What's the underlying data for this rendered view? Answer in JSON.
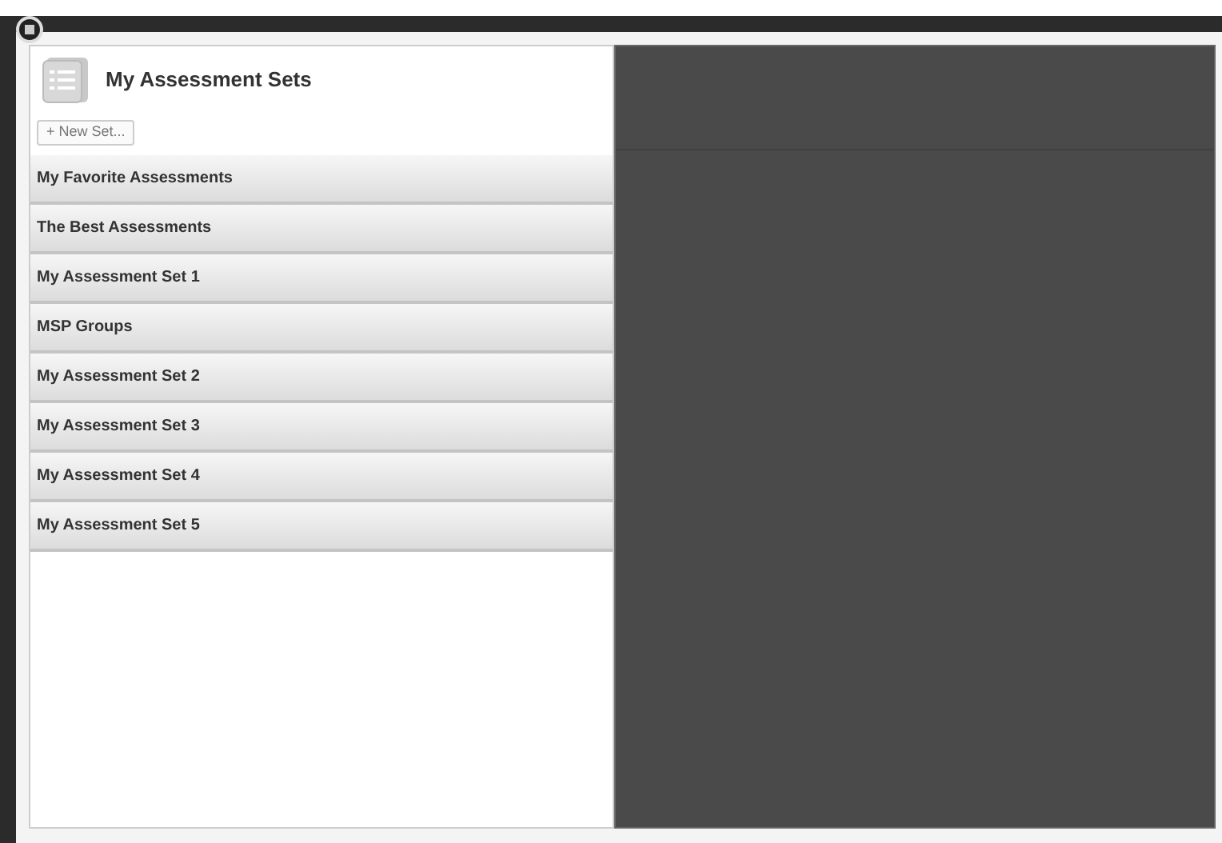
{
  "panel": {
    "title": "My Assessment Sets",
    "new_button": "+ New Set..."
  },
  "sets": [
    {
      "label": "My Favorite Assessments"
    },
    {
      "label": "The Best Assessments"
    },
    {
      "label": "My Assessment Set 1"
    },
    {
      "label": "MSP Groups"
    },
    {
      "label": "My Assessment Set 2"
    },
    {
      "label": "My Assessment Set 3"
    },
    {
      "label": "My Assessment Set 4"
    },
    {
      "label": "My Assessment Set 5"
    }
  ]
}
